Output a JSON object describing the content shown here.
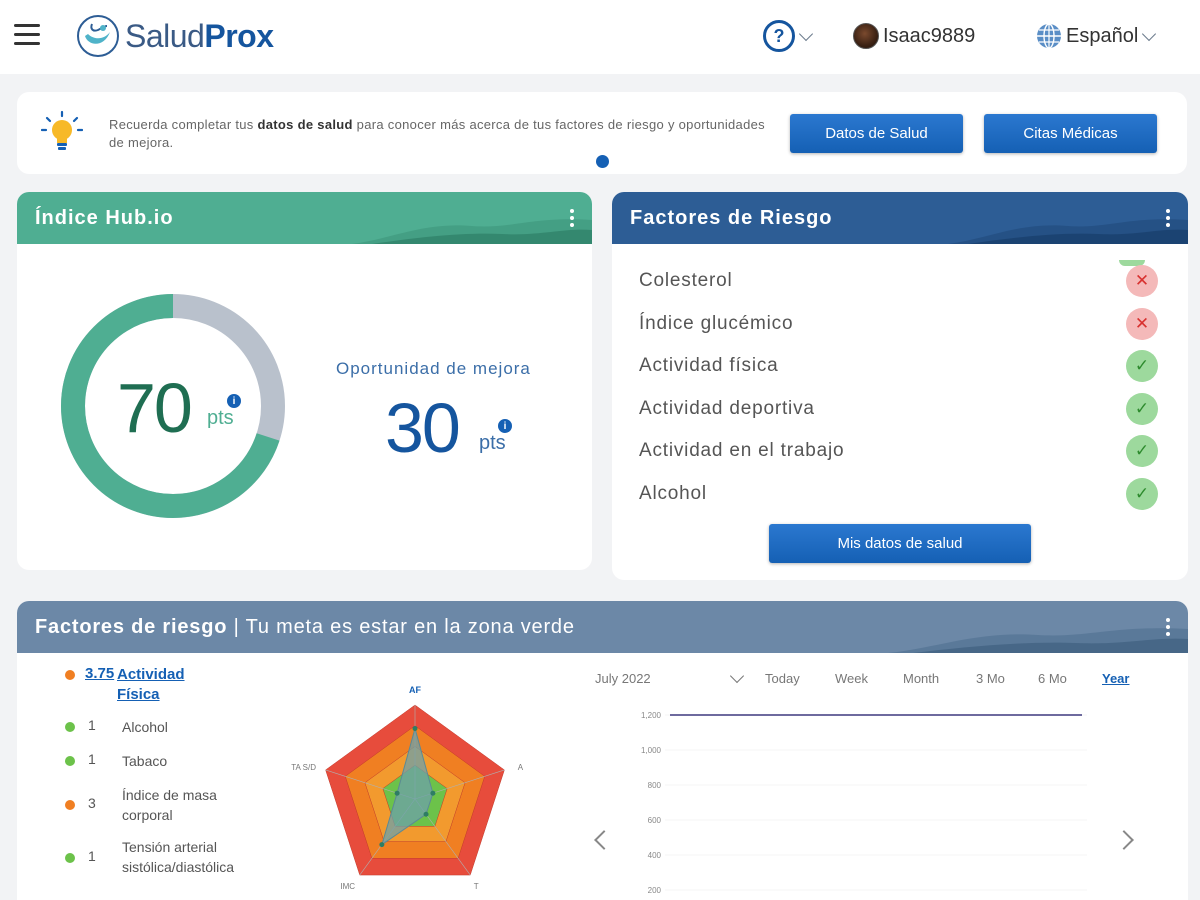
{
  "header": {
    "logo_part1": "Salud",
    "logo_part2": "Prox",
    "help_glyph": "?",
    "username": "Isaac9889",
    "language": "Español",
    "icons": [
      "menu-icon",
      "help-icon",
      "chevron-down-icon",
      "avatar",
      "globe-icon"
    ]
  },
  "tip": {
    "text_before": "Recuerda completar tus ",
    "text_bold": "datos de salud",
    "text_after": " para conocer más acerca de tus factores de riesgo y oportunidades de mejora.",
    "btn_datos": "Datos de Salud",
    "btn_citas": "Citas Médicas"
  },
  "hub": {
    "title": "Índice Hub.io",
    "score": "70",
    "score_unit": "pts",
    "score_fraction": 0.7,
    "opportunity_label": "Oportunidad de mejora",
    "opportunity_value": "30",
    "opportunity_unit": "pts",
    "info_glyph": "i"
  },
  "risk": {
    "title": "Factores de Riesgo",
    "items": [
      {
        "label": "Colesterol",
        "status": "bad",
        "glyph": "✕"
      },
      {
        "label": "Índice glucémico",
        "status": "bad",
        "glyph": "✕"
      },
      {
        "label": "Actividad física",
        "status": "good",
        "glyph": "✓"
      },
      {
        "label": "Actividad deportiva",
        "status": "good",
        "glyph": "✓"
      },
      {
        "label": "Actividad en el trabajo",
        "status": "good",
        "glyph": "✓"
      },
      {
        "label": "Alcohol",
        "status": "good",
        "glyph": "✓"
      }
    ],
    "button": "Mis datos de salud"
  },
  "bottom": {
    "title_bold": "Factores de riesgo",
    "title_sep": " | ",
    "title_rest": "Tu meta es estar en la zona verde",
    "legend": [
      {
        "value": "3.75",
        "label": "Actividad Física",
        "color": "#f07f22"
      },
      {
        "value": "1",
        "label": "Alcohol",
        "color": "#6cc24a"
      },
      {
        "value": "1",
        "label": "Tabaco",
        "color": "#6cc24a"
      },
      {
        "value": "3",
        "label": "Índice de masa corporal",
        "color": "#f07f22"
      },
      {
        "value": "1",
        "label": "Tensión arterial sistólica/diastólica",
        "color": "#6cc24a"
      }
    ],
    "radar": {
      "axes": [
        "AF",
        "A",
        "T",
        "IMC",
        "TA S/D"
      ],
      "values": [
        3.75,
        1,
        1,
        3,
        1
      ],
      "max": 5,
      "zone_colors": [
        "#6cc24a",
        "#f29a2e",
        "#f07f22",
        "#e74c3c"
      ]
    },
    "period": {
      "month": "July 2022",
      "options": [
        "Today",
        "Week",
        "Month",
        "3 Mo",
        "6 Mo",
        "Year"
      ],
      "selected": "Year"
    },
    "line_chart": {
      "y_ticks": [
        "1,200",
        "1,000",
        "800",
        "600",
        "400",
        "200"
      ],
      "series_value": 1200,
      "line_color": "#6e6a9e"
    }
  },
  "colors": {
    "hub_green": "#4fae92",
    "risk_blue": "#2d5d95",
    "bottom_slate": "#6c88a7",
    "ring_gray": "#b9c1cc",
    "primary": "#1560b4"
  }
}
